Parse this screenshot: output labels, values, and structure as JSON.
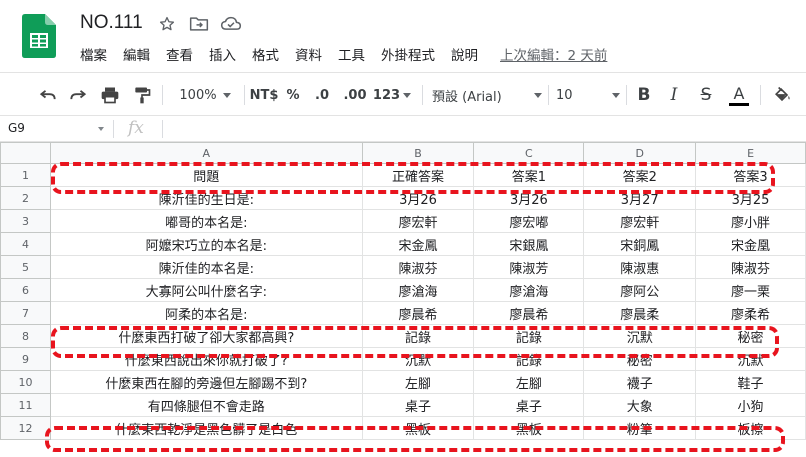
{
  "header": {
    "doc_title": "NO.111",
    "menu": [
      "檔案",
      "編輯",
      "查看",
      "插入",
      "格式",
      "資料",
      "工具",
      "外掛程式",
      "說明"
    ],
    "last_edit": "上次編輯：2 天前"
  },
  "toolbar": {
    "zoom": "100%",
    "currency": "NT$",
    "percent": "%",
    "decimal_decrease": ".0",
    "decimal_increase": ".00",
    "more_formats": "123",
    "font": "預設 (Arial)",
    "font_size": "10",
    "bold": "B",
    "italic": "I",
    "strike": "S",
    "text_color_letter": "A"
  },
  "formula_bar": {
    "cell_ref": "G9",
    "fx": "fx"
  },
  "colors": {
    "brand_green": "#0f9d58",
    "highlight_red": "#e8141e"
  },
  "sheet": {
    "columns": [
      "A",
      "B",
      "C",
      "D",
      "E"
    ],
    "rows": [
      {
        "n": "1",
        "cells": [
          "問題",
          "正確答案",
          "答案1",
          "答案2",
          "答案3"
        ]
      },
      {
        "n": "2",
        "cells": [
          "陳沂佳的生日是:",
          "3月26",
          "3月26",
          "3月27",
          "3月25"
        ]
      },
      {
        "n": "3",
        "cells": [
          "嘟哥的本名是:",
          "廖宏軒",
          "廖宏嘟",
          "廖宏軒",
          "廖小胖"
        ]
      },
      {
        "n": "4",
        "cells": [
          "阿嬤宋巧立的本名是:",
          "宋金鳳",
          "宋銀鳳",
          "宋銅鳳",
          "宋金凰"
        ]
      },
      {
        "n": "5",
        "cells": [
          "陳沂佳的本名是:",
          "陳淑芬",
          "陳淑芳",
          "陳淑惠",
          "陳淑芬"
        ]
      },
      {
        "n": "6",
        "cells": [
          "大寡阿公叫什麼名字:",
          "廖滄海",
          "廖滄海",
          "廖阿公",
          "廖一栗"
        ]
      },
      {
        "n": "7",
        "cells": [
          "阿柔的本名是:",
          "廖晨希",
          "廖晨希",
          "廖晨柔",
          "廖柔希"
        ]
      },
      {
        "n": "8",
        "cells": [
          "什麼東西打破了卻大家都高興?",
          "記錄",
          "記錄",
          "沉默",
          "秘密"
        ]
      },
      {
        "n": "9",
        "cells": [
          "什麼東西說出來你就打破了?",
          "沉默",
          "記錄",
          "秘密",
          "沉默"
        ]
      },
      {
        "n": "10",
        "cells": [
          "什麼東西在腳的旁邊但左腳踢不到?",
          "左腳",
          "左腳",
          "襪子",
          "鞋子"
        ]
      },
      {
        "n": "11",
        "cells": [
          "有四條腿但不會走路",
          "桌子",
          "桌子",
          "大象",
          "小狗"
        ]
      },
      {
        "n": "12",
        "cells": [
          "什麼東西乾淨是黑色髒了是白色",
          "黑板",
          "黑板",
          "粉筆",
          "板擦"
        ]
      }
    ]
  }
}
